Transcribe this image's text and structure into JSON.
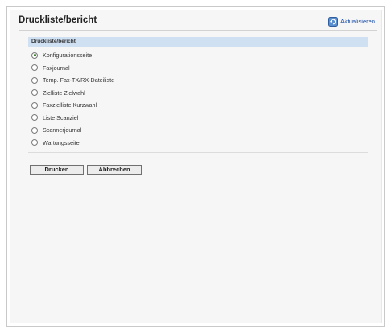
{
  "header": {
    "title": "Druckliste/bericht",
    "refresh_label": "Aktualisieren"
  },
  "section": {
    "label": "Druckliste/bericht"
  },
  "options": [
    {
      "label": "Konfigurationsseite",
      "selected": true
    },
    {
      "label": "Faxjournal",
      "selected": false
    },
    {
      "label": "Temp. Fax-TX/RX-Dateiliste",
      "selected": false
    },
    {
      "label": "Zielliste Zielwahl",
      "selected": false
    },
    {
      "label": "Faxzielliste Kurzwahl",
      "selected": false
    },
    {
      "label": "Liste Scanziel",
      "selected": false
    },
    {
      "label": "Scannerjournal",
      "selected": false
    },
    {
      "label": "Wartungsseite",
      "selected": false
    }
  ],
  "buttons": {
    "print_label": "Drucken",
    "cancel_label": "Abbrechen"
  },
  "colors": {
    "section_bar": "#cfe0f3",
    "link": "#1a4fa8",
    "radio_selected": "#3a7c2a"
  }
}
